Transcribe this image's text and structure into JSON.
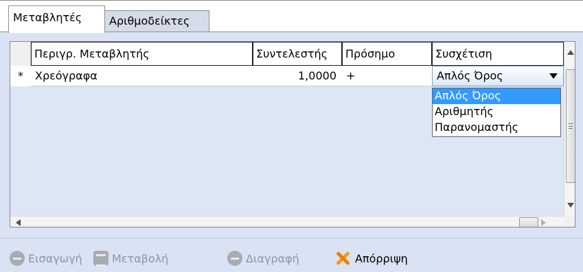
{
  "tabs": [
    {
      "label": "Μεταβλητές",
      "active": true
    },
    {
      "label": "Αριθμοδείκτες",
      "active": false
    }
  ],
  "grid": {
    "columns": [
      "Περιγρ. Μεταβλητής",
      "Συντελεστής",
      "Πρόσημο",
      "Συσχέτιση"
    ],
    "rows": [
      {
        "marker": "*",
        "description": "Χρεόγραφα",
        "coefficient": "1,0000",
        "sign": "+",
        "relation": "Απλός Όρος"
      }
    ],
    "relation_options": [
      "Απλός Όρος",
      "Αριθμητής",
      "Παρανομαστής"
    ],
    "selected_option_index": 0
  },
  "toolbar": {
    "insert_label": "Εισαγωγή",
    "edit_label": "Μεταβολή",
    "delete_label": "Διαγραφή",
    "reject_label": "Απόρριψη"
  },
  "colors": {
    "panel_bg": "#dae3f3",
    "selected_option": "#3399ff",
    "reject_icon": "#f59a1b"
  }
}
